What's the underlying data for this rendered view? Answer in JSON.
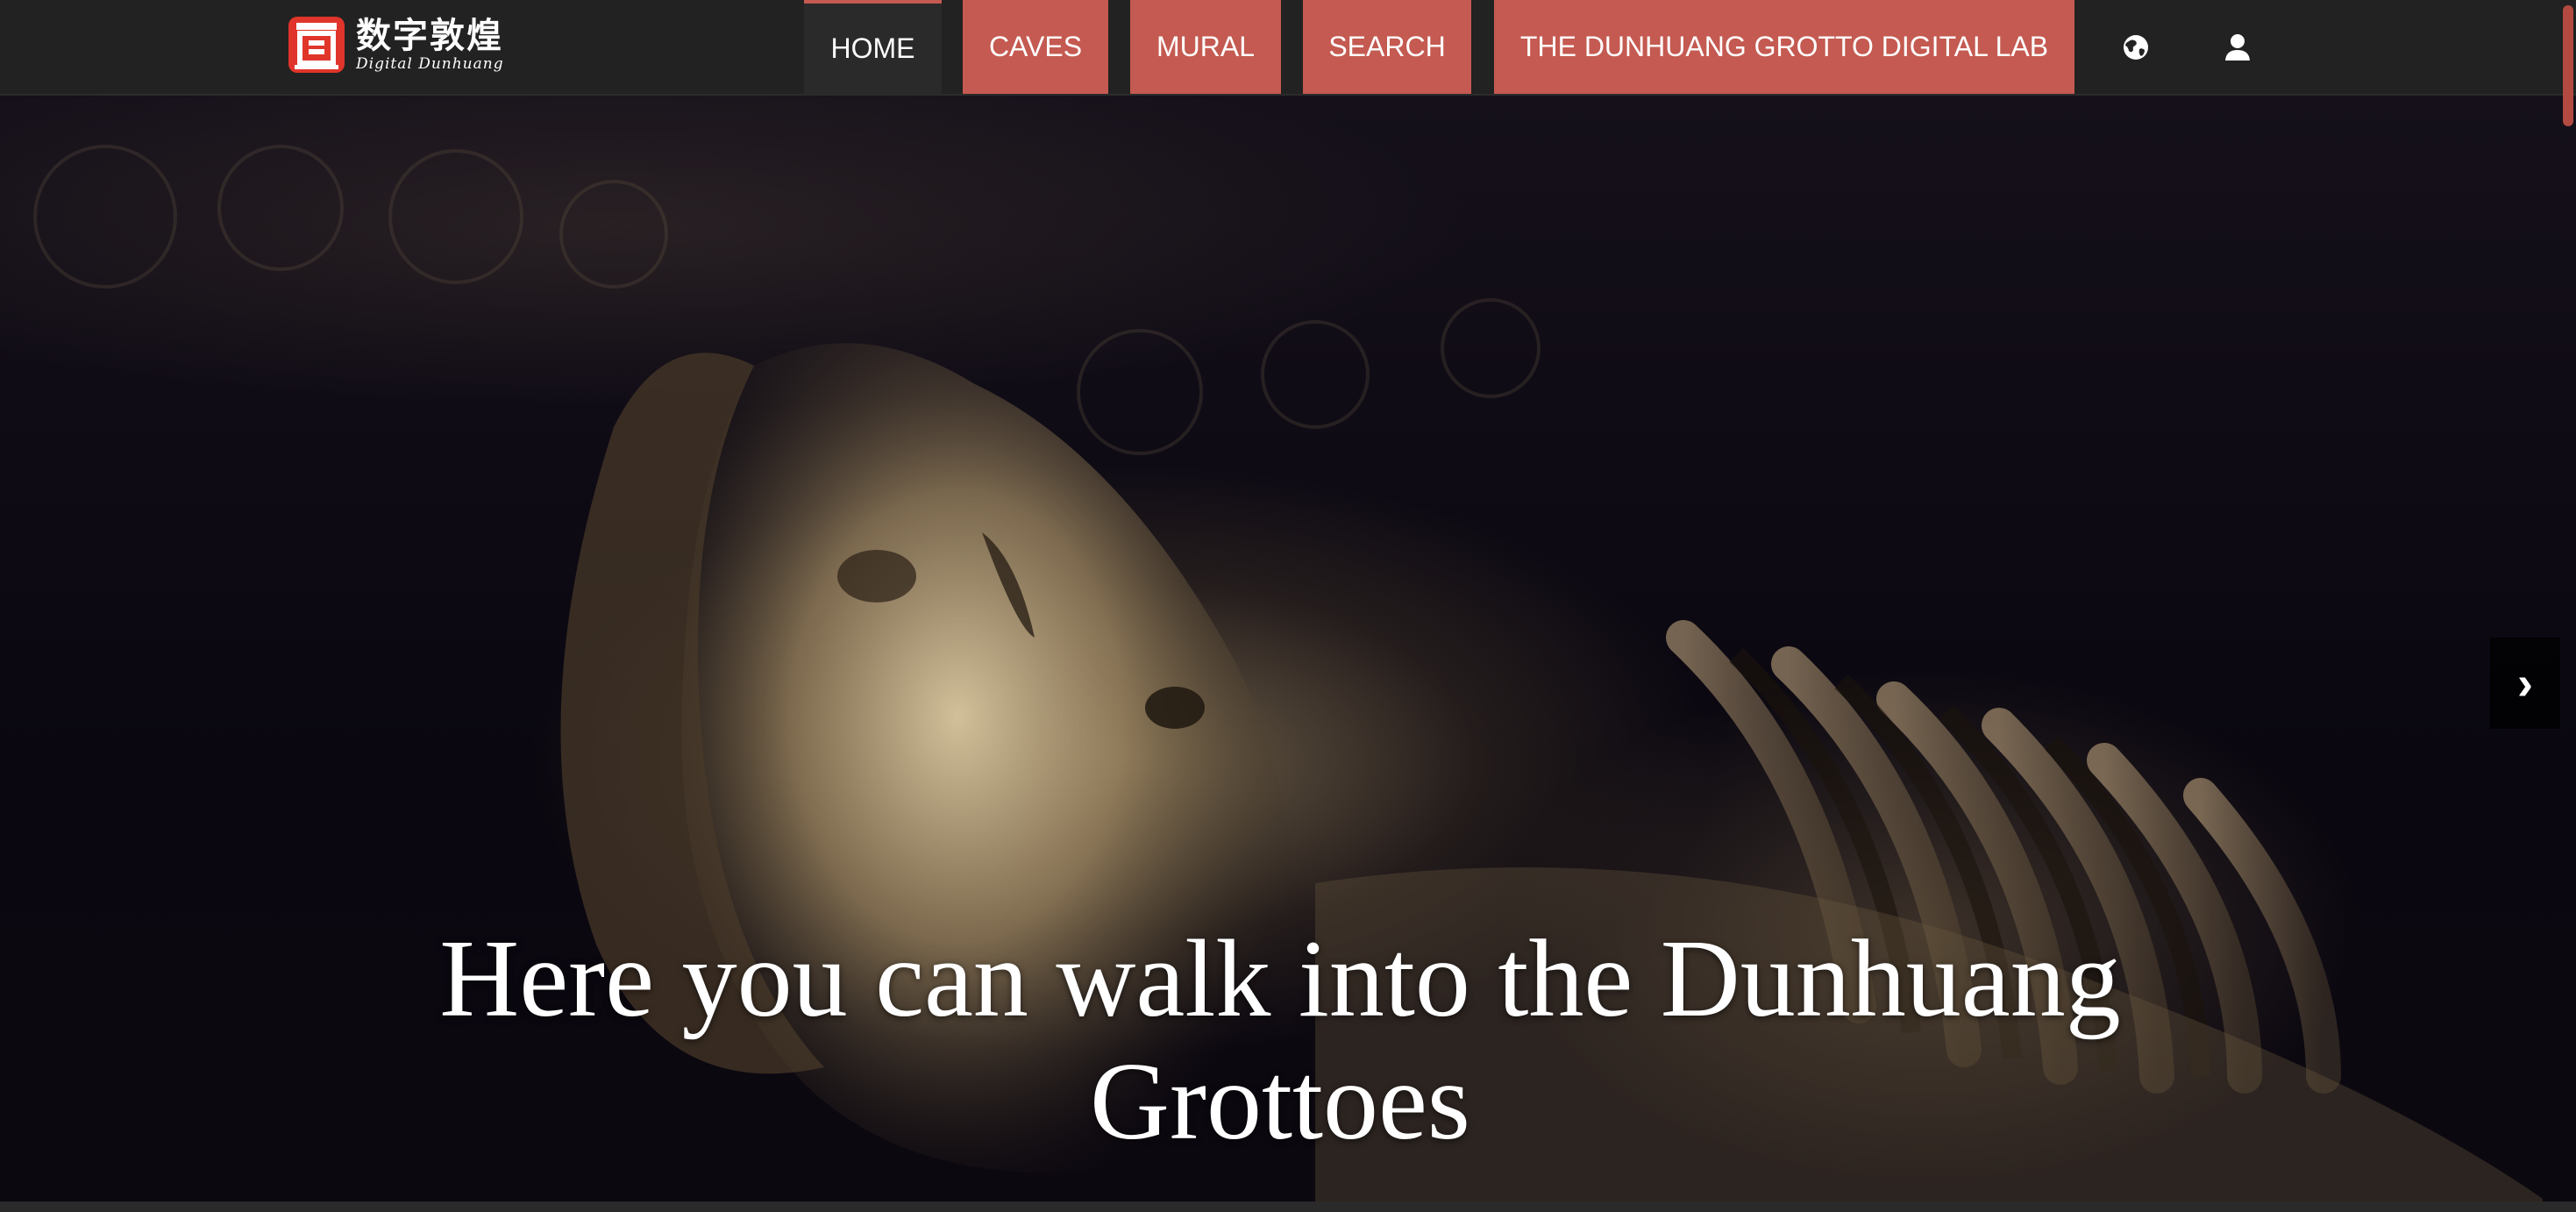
{
  "logo": {
    "chinese_text": "数字敦煌",
    "english_text": "Digital Dunhuang",
    "icon": "cave-logo-icon",
    "brand_color": "#e0352b"
  },
  "nav": {
    "items": [
      {
        "label": "HOME",
        "active": true
      },
      {
        "label": "CAVES",
        "active": false
      },
      {
        "label": "MURAL",
        "active": false
      },
      {
        "label": "SEARCH",
        "active": false
      },
      {
        "label": "THE DUNHUANG GROTTO DIGITAL LAB",
        "active": false
      }
    ],
    "icons": [
      "globe-icon",
      "user-icon"
    ],
    "accent_color": "#c45a51",
    "bar_color": "#222222"
  },
  "hero": {
    "caption": "Here you can walk into the Dunhuang Grottoes",
    "next_symbol": "›"
  }
}
